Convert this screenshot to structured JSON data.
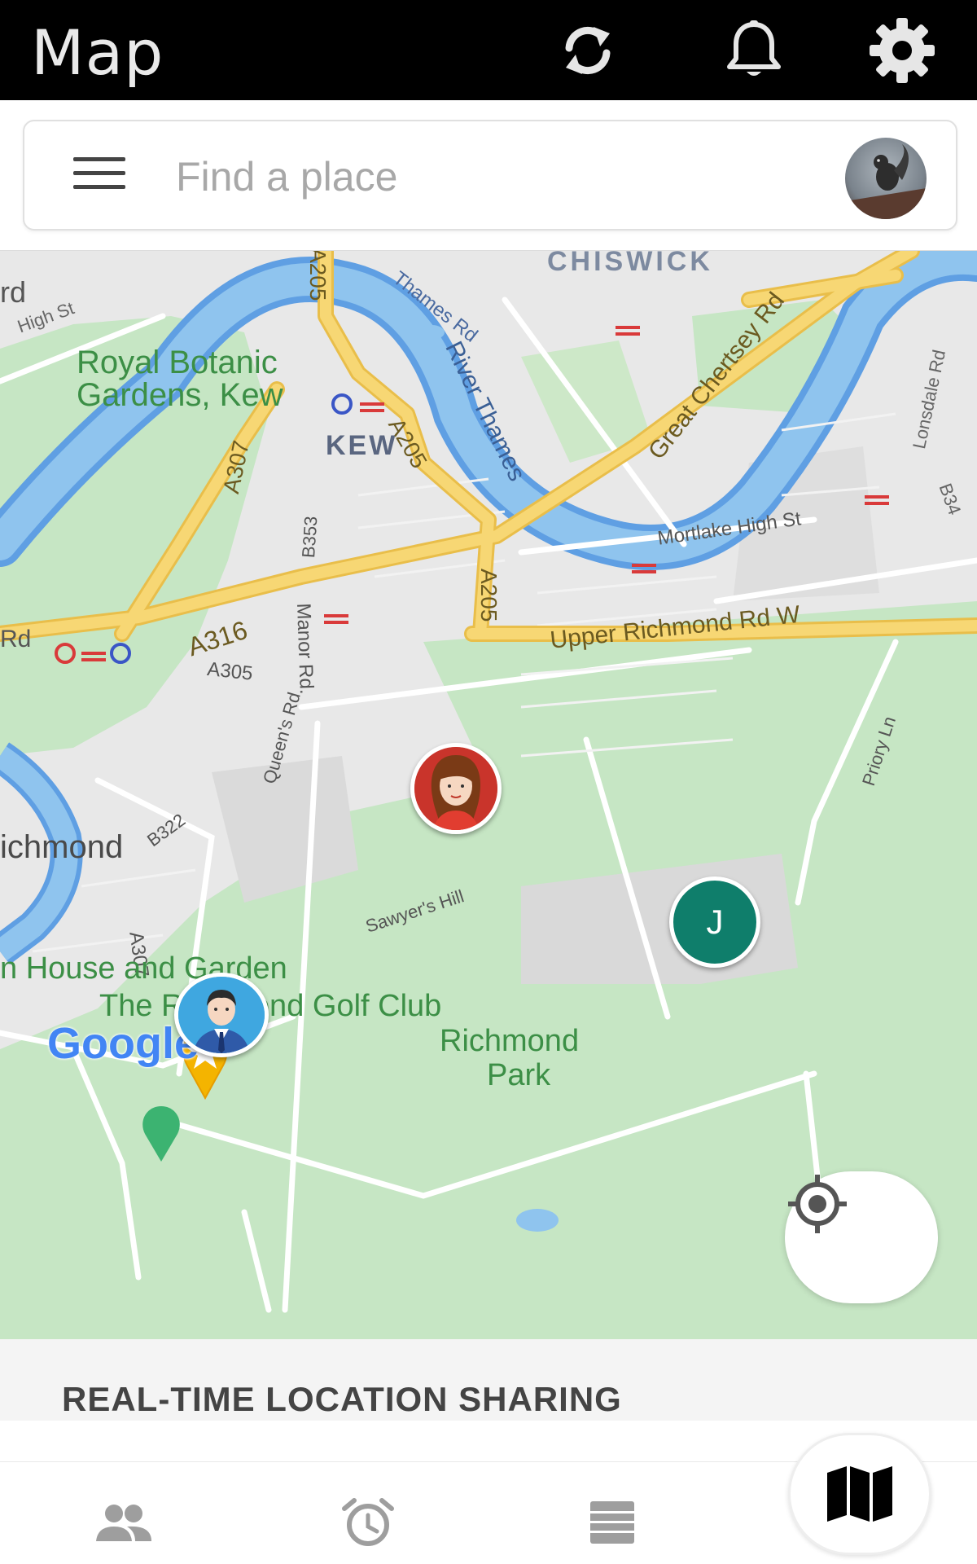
{
  "header": {
    "title": "Map",
    "icons": {
      "refresh": "refresh-icon",
      "notifications": "bell-icon",
      "settings": "gear-icon"
    }
  },
  "search": {
    "placeholder": "Find a place",
    "menu_icon": "menu-icon",
    "avatar": "user-avatar-squirrel"
  },
  "map": {
    "labels": {
      "chiswick": "CHISWICK",
      "kew": "KEW",
      "royal_botanic_1": "Royal Botanic",
      "royal_botanic_2": "Gardens, Kew",
      "richmond": "ichmond",
      "rd_top": "rd",
      "rd_mid": "Rd",
      "high_st": "High St",
      "thames_rd": "Thames Rd",
      "river_thames": "River Thames",
      "great_chertsey": "Great Chertsey Rd",
      "lonsdale": "Lonsdale Rd",
      "b34": "B34",
      "mortlake": "Mortlake High St",
      "upper_richmond": "Upper Richmond Rd W",
      "a205_top": "A205",
      "a205_mid": "A205",
      "a205_low": "A205",
      "a307": "A307",
      "a307_low": "A307",
      "b353": "B353",
      "a316": "A316",
      "manor_rd": "Manor Rd.",
      "a305": "A305",
      "queens_rd": "Queen's Rd",
      "b322": "B322",
      "priory_ln": "Priory Ln",
      "sawyers_hill": "Sawyer's Hill",
      "house_garden": "n House and Garden",
      "golf_club": "The R     mond Golf Club",
      "richmond_park_1": "Richmond",
      "richmond_park_2": "Park",
      "google": "Google"
    },
    "markers": [
      {
        "name": "woman-avatar",
        "initial": ""
      },
      {
        "name": "contact-j",
        "initial": "J",
        "color": "#0f7e6b"
      },
      {
        "name": "man-avatar",
        "initial": ""
      }
    ],
    "colors": {
      "water": "#8fc4ee",
      "river_stroke": "#5f9fe3",
      "park": "#c6e6c4",
      "road_major": "#f7d774",
      "road_edge": "#e9be4a",
      "background": "#e8e8e8"
    }
  },
  "sharing": {
    "label": "REAL-TIME LOCATION SHARING"
  },
  "bottom_nav": {
    "items": [
      "people-icon",
      "alarm-icon",
      "list-icon",
      "map-icon"
    ],
    "active": "map-icon"
  }
}
